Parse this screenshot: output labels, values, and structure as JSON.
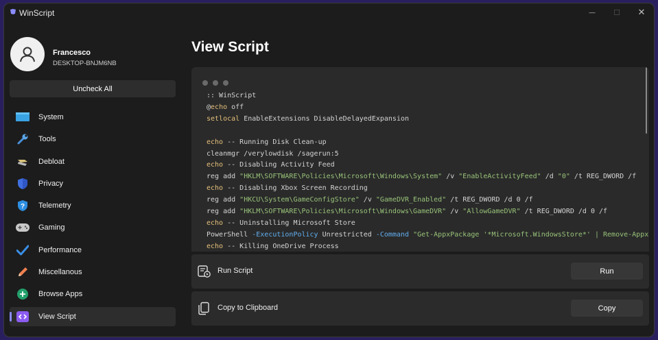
{
  "window": {
    "title": "WinScript",
    "minimize": "—",
    "maximize": "☐",
    "close": "✕"
  },
  "user": {
    "name": "Francesco",
    "host": "DESKTOP-BNJM6NB"
  },
  "sidebar": {
    "uncheck_label": "Uncheck All",
    "items": [
      {
        "label": "System",
        "icon": "monitor-icon"
      },
      {
        "label": "Tools",
        "icon": "wrench-icon"
      },
      {
        "label": "Debloat",
        "icon": "broom-icon"
      },
      {
        "label": "Privacy",
        "icon": "shield-icon"
      },
      {
        "label": "Telemetry",
        "icon": "shield-question-icon"
      },
      {
        "label": "Gaming",
        "icon": "gamepad-icon"
      },
      {
        "label": "Performance",
        "icon": "checkmark-icon"
      },
      {
        "label": "Miscellanous",
        "icon": "pencil-icon"
      },
      {
        "label": "Browse Apps",
        "icon": "plus-circle-icon"
      },
      {
        "label": "View Script",
        "icon": "code-icon",
        "active": true
      }
    ]
  },
  "main": {
    "title": "View Script",
    "code_lines": [
      ":: WinScript",
      "@echo off",
      "setlocal EnableExtensions DisableDelayedExpansion",
      "",
      "echo -- Running Disk Clean-up",
      "cleanmgr /verylowdisk /sagerun:5",
      "echo -- Disabling Activity Feed",
      "reg add \"HKLM\\SOFTWARE\\Policies\\Microsoft\\Windows\\System\" /v \"EnableActivityFeed\" /d \"0\" /t REG_DWORD /f",
      "echo -- Disabling Xbox Screen Recording",
      "reg add \"HKCU\\System\\GameConfigStore\" /v \"GameDVR_Enabled\" /t REG_DWORD /d 0 /f",
      "reg add \"HKLM\\SOFTWARE\\Policies\\Microsoft\\Windows\\GameDVR\" /v \"AllowGameDVR\" /t REG_DWORD /d 0 /f",
      "echo -- Uninstalling Microsoft Store",
      "PowerShell -ExecutionPolicy Unrestricted -Command \"Get-AppxPackage '*Microsoft.WindowsStore*' | Remove-AppxPackage\"",
      "echo -- Killing OneDrive Process"
    ],
    "run_card": {
      "label": "Run Script",
      "button": "Run"
    },
    "copy_card": {
      "label": "Copy to Clipboard",
      "button": "Copy"
    }
  },
  "colors": {
    "accent": "#8a8cff",
    "keyword": "#e5c07b",
    "string": "#98c379",
    "parameter": "#61afef",
    "background": "#1c1c1c"
  }
}
